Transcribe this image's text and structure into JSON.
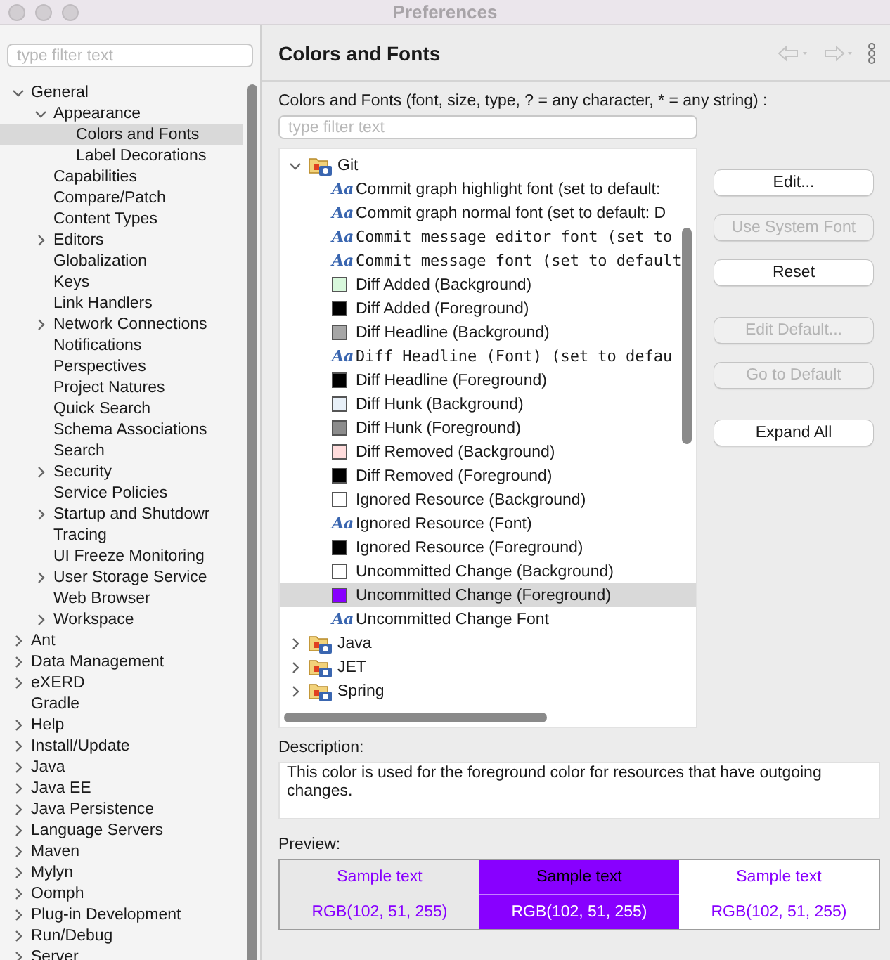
{
  "window": {
    "title": "Preferences"
  },
  "sidebar": {
    "filter": {
      "placeholder": "type filter text"
    },
    "items": [
      {
        "label": "General",
        "selected": false,
        "expanded": true,
        "children": [
          {
            "label": "Appearance",
            "selected": false,
            "expanded": true,
            "children": [
              {
                "label": "Colors and Fonts",
                "selected": true
              },
              {
                "label": "Label Decorations",
                "selected": false
              }
            ]
          },
          {
            "label": "Capabilities",
            "selected": false
          },
          {
            "label": "Compare/Patch",
            "selected": false
          },
          {
            "label": "Content Types",
            "selected": false
          },
          {
            "label": "Editors",
            "selected": false,
            "expanded": false
          },
          {
            "label": "Globalization",
            "selected": false
          },
          {
            "label": "Keys",
            "selected": false
          },
          {
            "label": "Link Handlers",
            "selected": false
          },
          {
            "label": "Network Connections",
            "selected": false,
            "expanded": false
          },
          {
            "label": "Notifications",
            "selected": false
          },
          {
            "label": "Perspectives",
            "selected": false
          },
          {
            "label": "Project Natures",
            "selected": false
          },
          {
            "label": "Quick Search",
            "selected": false
          },
          {
            "label": "Schema Associations",
            "selected": false
          },
          {
            "label": "Search",
            "selected": false
          },
          {
            "label": "Security",
            "selected": false,
            "expanded": false
          },
          {
            "label": "Service Policies",
            "selected": false
          },
          {
            "label": "Startup and Shutdowr",
            "selected": false,
            "expanded": false
          },
          {
            "label": "Tracing",
            "selected": false
          },
          {
            "label": "UI Freeze Monitoring",
            "selected": false
          },
          {
            "label": "User Storage Service",
            "selected": false,
            "expanded": false
          },
          {
            "label": "Web Browser",
            "selected": false
          },
          {
            "label": "Workspace",
            "selected": false,
            "expanded": false
          }
        ]
      },
      {
        "label": "Ant",
        "selected": false,
        "expanded": false
      },
      {
        "label": "Data Management",
        "selected": false,
        "expanded": false
      },
      {
        "label": "eXERD",
        "selected": false,
        "expanded": false
      },
      {
        "label": "Gradle",
        "selected": false
      },
      {
        "label": "Help",
        "selected": false,
        "expanded": false
      },
      {
        "label": "Install/Update",
        "selected": false,
        "expanded": false
      },
      {
        "label": "Java",
        "selected": false,
        "expanded": false
      },
      {
        "label": "Java EE",
        "selected": false,
        "expanded": false
      },
      {
        "label": "Java Persistence",
        "selected": false,
        "expanded": false
      },
      {
        "label": "Language Servers",
        "selected": false,
        "expanded": false
      },
      {
        "label": "Maven",
        "selected": false,
        "expanded": false
      },
      {
        "label": "Mylyn",
        "selected": false,
        "expanded": false
      },
      {
        "label": "Oomph",
        "selected": false,
        "expanded": false
      },
      {
        "label": "Plug-in Development",
        "selected": false,
        "expanded": false
      },
      {
        "label": "Run/Debug",
        "selected": false,
        "expanded": false
      },
      {
        "label": "Server",
        "selected": false,
        "expanded": false
      }
    ]
  },
  "page": {
    "title": "Colors and Fonts",
    "filter_label": "Colors and Fonts (font, size, type, ? = any character, * = any string) :",
    "filter": {
      "placeholder": "type filter text"
    },
    "tree": [
      {
        "label": "Git",
        "selected": false,
        "expanded": true,
        "children": [
          {
            "kind": "font",
            "glyph": "Aa",
            "monospace": false,
            "label": "Commit graph highlight font (set to default:",
            "selected": false
          },
          {
            "kind": "font",
            "glyph": "Aa",
            "monospace": false,
            "label": "Commit graph normal font (set to default: D",
            "selected": false
          },
          {
            "kind": "font",
            "glyph": "Aa",
            "monospace": true,
            "label": "Commit message editor font (set to",
            "selected": false
          },
          {
            "kind": "font",
            "glyph": "Aa",
            "monospace": true,
            "label": "Commit message font (set to default",
            "selected": false
          },
          {
            "kind": "color",
            "color": "#d8f8dc",
            "label": "Diff Added (Background)",
            "selected": false
          },
          {
            "kind": "color",
            "color": "#000000",
            "label": "Diff Added (Foreground)",
            "selected": false
          },
          {
            "kind": "color",
            "color": "#a6a6a6",
            "label": "Diff Headline (Background)",
            "selected": false
          },
          {
            "kind": "font",
            "glyph": "Aa",
            "monospace": true,
            "label": "Diff Headline (Font) (set to defau",
            "selected": false
          },
          {
            "kind": "color",
            "color": "#000000",
            "label": "Diff Headline (Foreground)",
            "selected": false
          },
          {
            "kind": "color",
            "color": "#e8f0f8",
            "label": "Diff Hunk (Background)",
            "selected": false
          },
          {
            "kind": "color",
            "color": "#8c8c8c",
            "label": "Diff Hunk (Foreground)",
            "selected": false
          },
          {
            "kind": "color",
            "color": "#ffdcdc",
            "label": "Diff Removed (Background)",
            "selected": false
          },
          {
            "kind": "color",
            "color": "#000000",
            "label": "Diff Removed (Foreground)",
            "selected": false
          },
          {
            "kind": "color",
            "color": "#ffffff",
            "label": "Ignored Resource (Background)",
            "selected": false
          },
          {
            "kind": "font",
            "glyph": "Aa",
            "monospace": false,
            "label": "Ignored Resource (Font)",
            "selected": false
          },
          {
            "kind": "color",
            "color": "#000000",
            "label": "Ignored Resource (Foreground)",
            "selected": false
          },
          {
            "kind": "color",
            "color": "#ffffff",
            "label": "Uncommitted Change (Background)",
            "selected": false
          },
          {
            "kind": "color",
            "color": "#8800ff",
            "label": "Uncommitted Change (Foreground)",
            "selected": true
          },
          {
            "kind": "font",
            "glyph": "Aa",
            "monospace": false,
            "label": "Uncommitted Change Font",
            "selected": false
          }
        ]
      },
      {
        "label": "Java",
        "selected": false,
        "expanded": false
      },
      {
        "label": "JET",
        "selected": false,
        "expanded": false
      },
      {
        "label": "Spring",
        "selected": false,
        "expanded": false
      }
    ],
    "buttons": [
      {
        "label": "Edit...",
        "disabled": false
      },
      {
        "label": "Use System Font",
        "disabled": true
      },
      {
        "label": "Reset",
        "disabled": false
      },
      {
        "label": "Edit Default...",
        "disabled": true
      },
      {
        "label": "Go to Default",
        "disabled": true
      },
      {
        "label": "Expand All",
        "disabled": false
      }
    ],
    "description_label": "Description:",
    "description": "This color is used for the foreground color for resources that have outgoing changes.",
    "preview_label": "Preview:",
    "preview": [
      {
        "kind": "grey",
        "color": "#8800ff",
        "sample": "Sample text",
        "value": "RGB(102, 51, 255)"
      },
      {
        "kind": "fill",
        "color": "#8800ff",
        "sample": "Sample text",
        "value": "RGB(102, 51, 255)"
      },
      {
        "kind": "white",
        "color": "#8800ff",
        "sample": "Sample text",
        "value": "RGB(102, 51, 255)"
      }
    ]
  }
}
